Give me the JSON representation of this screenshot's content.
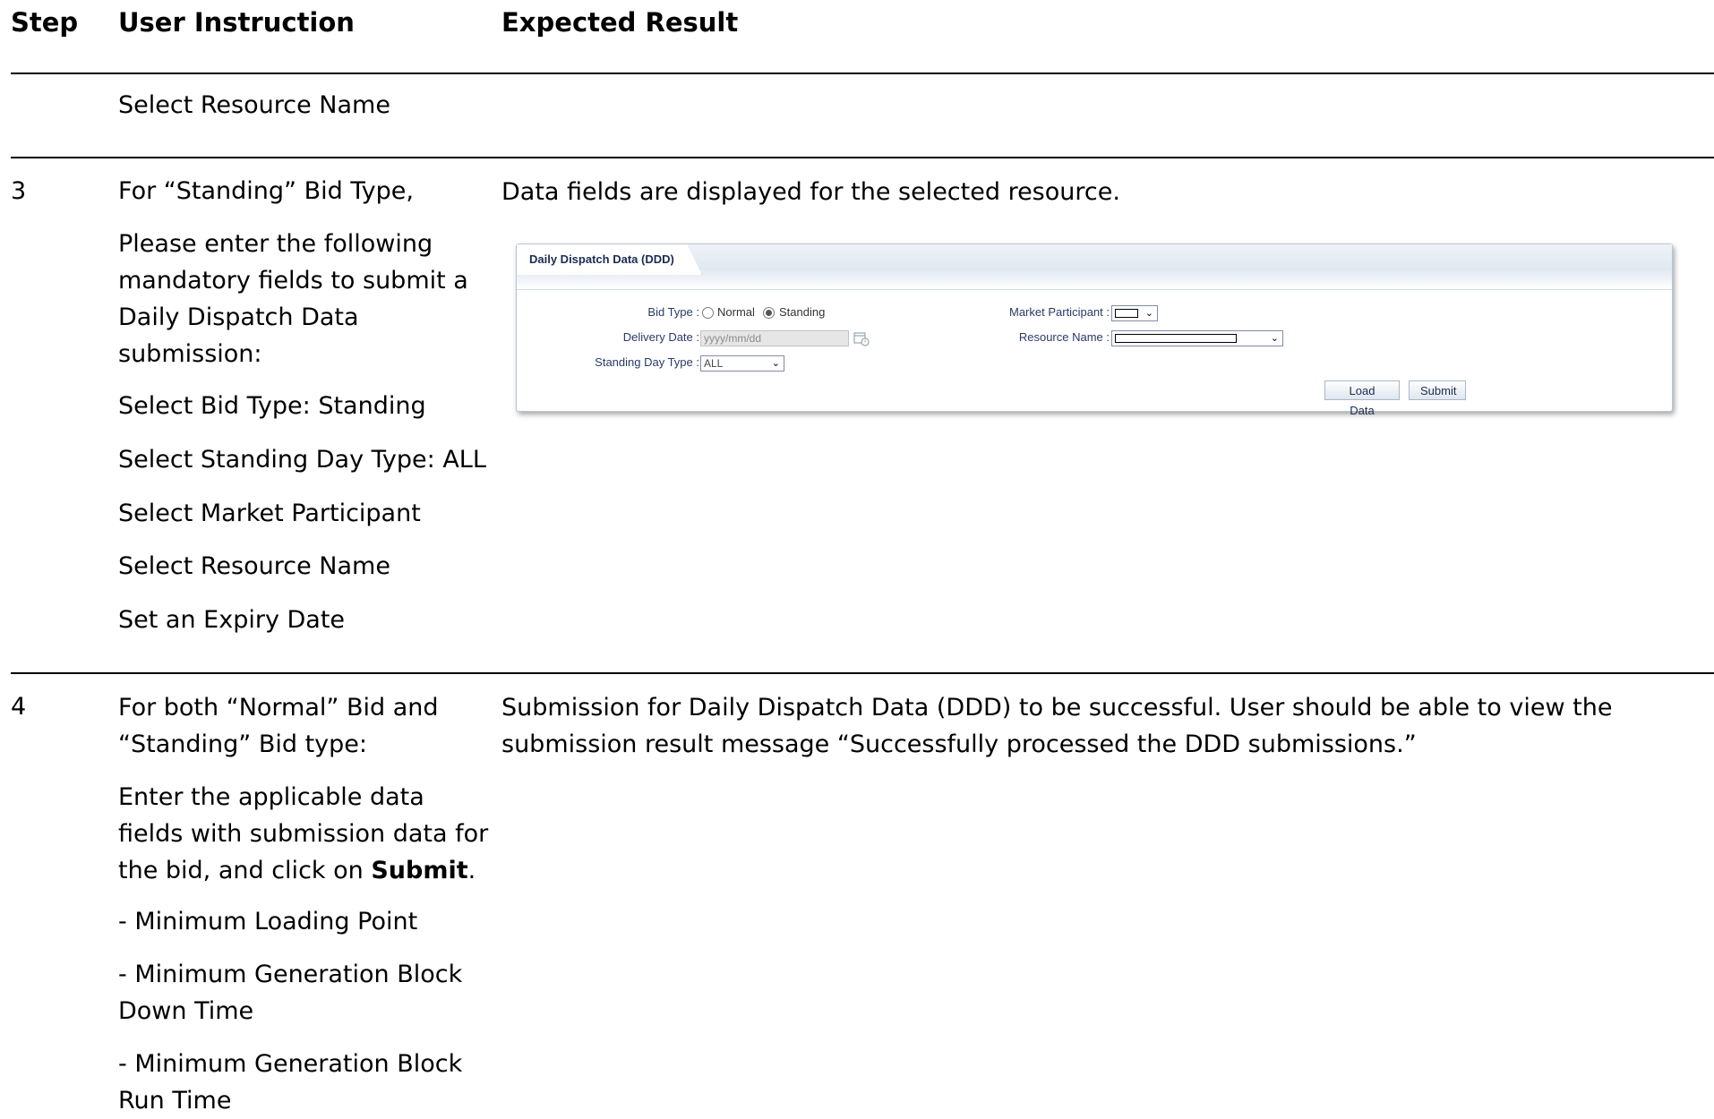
{
  "table": {
    "headers": {
      "step": "Step",
      "instruction": "User Instruction",
      "result": "Expected Result"
    },
    "row_prev": {
      "instruction": "Select Resource Name"
    },
    "row3": {
      "step": "3",
      "instructions": [
        "For “Standing” Bid Type,",
        "Please enter the following mandatory fields to submit a Daily Dispatch Data submission:",
        "Select Bid Type: Standing",
        "Select Standing Day Type: ALL",
        "Select Market Participant",
        "Select Resource Name",
        "Set an Expiry Date"
      ],
      "result": "Data fields are displayed for the selected resource."
    },
    "row4": {
      "step": "4",
      "instr_intro": "For both “Normal” Bid and “Standing” Bid type:",
      "instr_action_pre": "Enter the applicable data fields with submission data for the bid, and click on ",
      "instr_action_bold": "Submit",
      "instr_action_post": ".",
      "bullets": [
        "- Minimum Loading Point",
        "- Minimum Generation Block Down Time",
        "- Minimum Generation Block Run Time"
      ],
      "result": "Submission for Daily Dispatch Data (DDD) to be successful. User should be able to view the submission result message “Successfully processed the DDD submissions.”"
    }
  },
  "ddd_panel": {
    "tab_title": "Daily Dispatch Data (DDD)",
    "bid_type_label": "Bid Type :",
    "bid_type_options": [
      "Normal",
      "Standing"
    ],
    "bid_type_selected": "Standing",
    "delivery_date_label": "Delivery Date :",
    "delivery_date_placeholder": "yyyy/mm/dd",
    "standing_day_type_label": "Standing Day Type :",
    "standing_day_type_value": "ALL",
    "market_participant_label": "Market Participant :",
    "market_participant_value": "",
    "resource_name_label": "Resource Name :",
    "resource_name_value": "",
    "load_data_button": "Load Data",
    "submit_button": "Submit",
    "colors": {
      "label": "#2a3a66",
      "border": "#b9c6d6"
    }
  }
}
